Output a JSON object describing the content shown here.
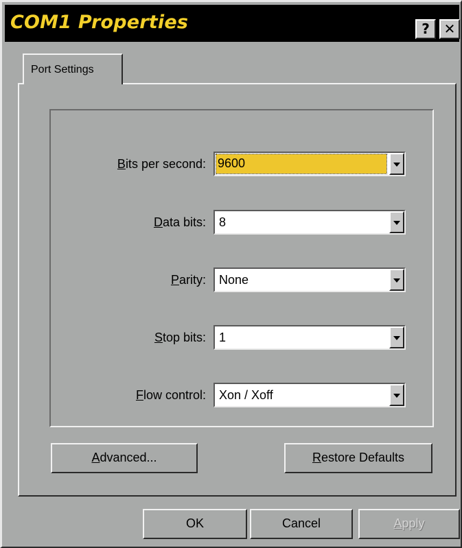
{
  "window": {
    "title": "COM1 Properties",
    "help_glyph": "?",
    "close_glyph": "✕"
  },
  "tabs": [
    {
      "label": "Port Settings",
      "selected": true
    }
  ],
  "fields": {
    "bits_per_second": {
      "label_mn": "B",
      "label_rest": "its per second:",
      "value": "9600",
      "focused": true
    },
    "data_bits": {
      "label_mn": "D",
      "label_rest": "ata bits:",
      "value": "8"
    },
    "parity": {
      "label_mn": "P",
      "label_rest": "arity:",
      "value": "None"
    },
    "stop_bits": {
      "label_mn": "S",
      "label_rest": "top bits:",
      "value": "1"
    },
    "flow_control": {
      "label_mn": "F",
      "label_rest": "low control:",
      "value": "Xon / Xoff"
    }
  },
  "buttons": {
    "advanced_mn": "A",
    "advanced_rest": "dvanced...",
    "restore_mn": "R",
    "restore_rest": "estore Defaults",
    "ok": "OK",
    "cancel": "Cancel",
    "apply_mn": "A",
    "apply_rest": "pply",
    "apply_enabled": false
  },
  "colors": {
    "title_text": "#f3d02a",
    "title_bar": "#000000",
    "focus_highlight": "#eec62d",
    "window_face": "#a8aaa9"
  }
}
